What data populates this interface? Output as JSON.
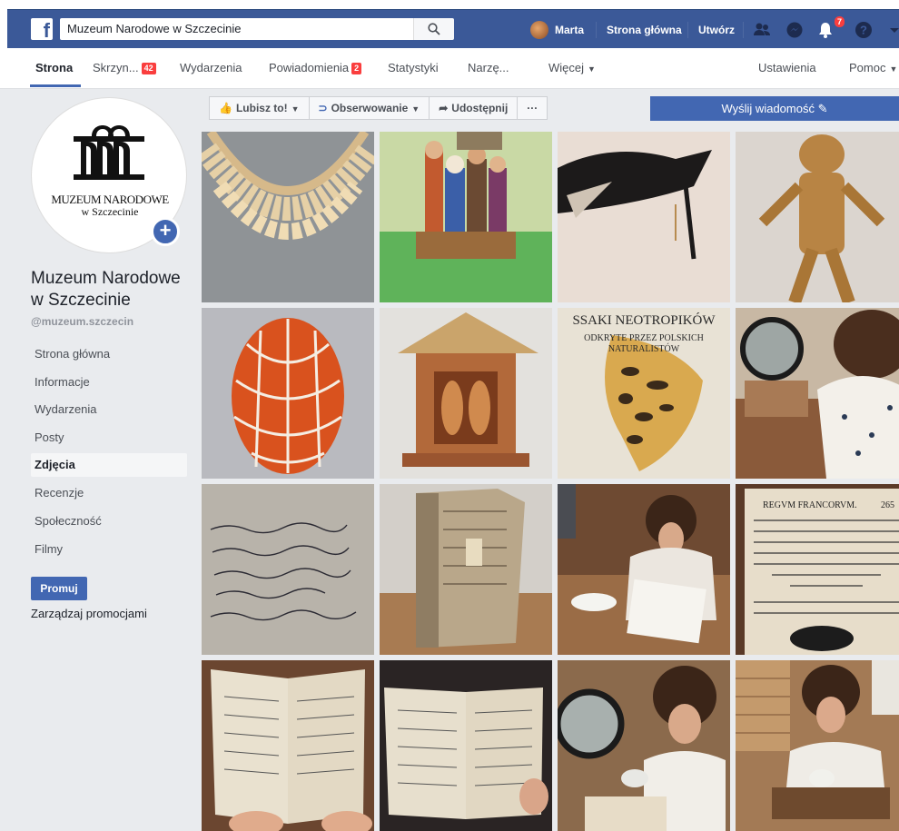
{
  "topbar": {
    "search_value": "Muzeum Narodowe w Szczecinie",
    "user_name": "Marta",
    "home_label": "Strona główna",
    "create_label": "Utwórz",
    "notification_count": "7"
  },
  "tabs": [
    {
      "label": "Strona"
    },
    {
      "label": "Skrzyn...",
      "badge": "42"
    },
    {
      "label": "Wydarzenia"
    },
    {
      "label": "Powiadomienia",
      "badge": "2"
    },
    {
      "label": "Statystyki"
    },
    {
      "label": "Narzę..."
    },
    {
      "label": "Więcej"
    },
    {
      "label": "Ustawienia"
    },
    {
      "label": "Pomoc"
    }
  ],
  "profile": {
    "logo_line1": "MUZEUM NARODOWE",
    "logo_line2": "w Szczecinie",
    "name": "Muzeum Narodowe w Szczecinie",
    "handle": "@muzeum.szczecin"
  },
  "sidebar": {
    "items": [
      {
        "label": "Strona główna"
      },
      {
        "label": "Informacje"
      },
      {
        "label": "Wydarzenia"
      },
      {
        "label": "Posty"
      },
      {
        "label": "Zdjęcia"
      },
      {
        "label": "Recenzje"
      },
      {
        "label": "Społeczność"
      },
      {
        "label": "Filmy"
      }
    ],
    "promote_label": "Promuj",
    "manage_label": "Zarządzaj promocjami"
  },
  "actions": {
    "like_label": "Lubisz to!",
    "follow_label": "Obserwowanie",
    "share_label": "Udostępnij",
    "more_label": "···",
    "message_label": "Wyślij wiadomość"
  },
  "photos": {
    "book_title_line1": "SSAKI NEOTROPIKÓW",
    "book_title_line2": "ODKRYTE PRZEZ POLSKICH",
    "book_title_line3": "NATURALISTÓW",
    "latin_heading": "REGVM FRANCORVM.",
    "latin_page": "265"
  },
  "colors": {
    "brand": "#3b5998",
    "accent": "#4267b2",
    "badge": "#fa3e3e"
  }
}
